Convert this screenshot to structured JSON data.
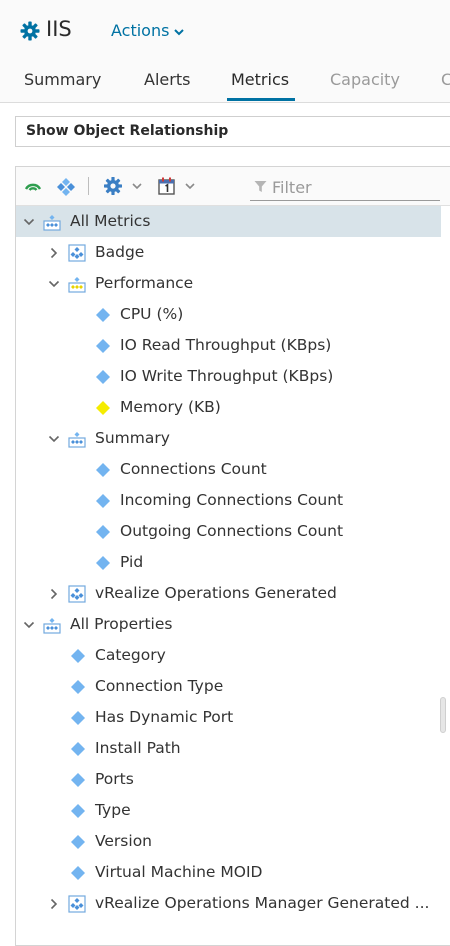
{
  "header": {
    "title": "IIS",
    "actions_label": "Actions",
    "accent_color": "#0072a3"
  },
  "tabs": [
    {
      "label": "Summary",
      "state": "normal"
    },
    {
      "label": "Alerts",
      "state": "normal"
    },
    {
      "label": "Metrics",
      "state": "active"
    },
    {
      "label": "Capacity",
      "state": "disabled"
    },
    {
      "label": "C",
      "state": "disabled"
    }
  ],
  "relation_bar": {
    "label": "Show Object Relationship"
  },
  "toolbar": {
    "filter_placeholder": "Filter",
    "icons": [
      "signal-icon",
      "diamond-cluster-icon",
      "gear-icon",
      "calendar-icon"
    ]
  },
  "tree": {
    "all_metrics": "All Metrics",
    "badge": "Badge",
    "performance": "Performance",
    "cpu": "CPU (%)",
    "io_read": "IO Read Throughput (KBps)",
    "io_write": "IO Write Throughput (KBps)",
    "memory": "Memory (KB)",
    "summary": "Summary",
    "connections_count": "Connections Count",
    "incoming_connections": "Incoming Connections Count",
    "outgoing_connections": "Outgoing Connections Count",
    "pid": "Pid",
    "vrops_generated": "vRealize Operations Generated",
    "all_properties": "All Properties",
    "category": "Category",
    "connection_type": "Connection Type",
    "has_dynamic_port": "Has Dynamic Port",
    "install_path": "Install Path",
    "ports": "Ports",
    "type": "Type",
    "version": "Version",
    "vm_moid": "Virtual Machine MOID",
    "vrops_manager_generated": "vRealize Operations Manager Generated ..."
  },
  "colors": {
    "metric_diamond": "#73b4f0",
    "highlight_diamond": "#f5ec00",
    "selected_row": "#d8e3e9"
  }
}
